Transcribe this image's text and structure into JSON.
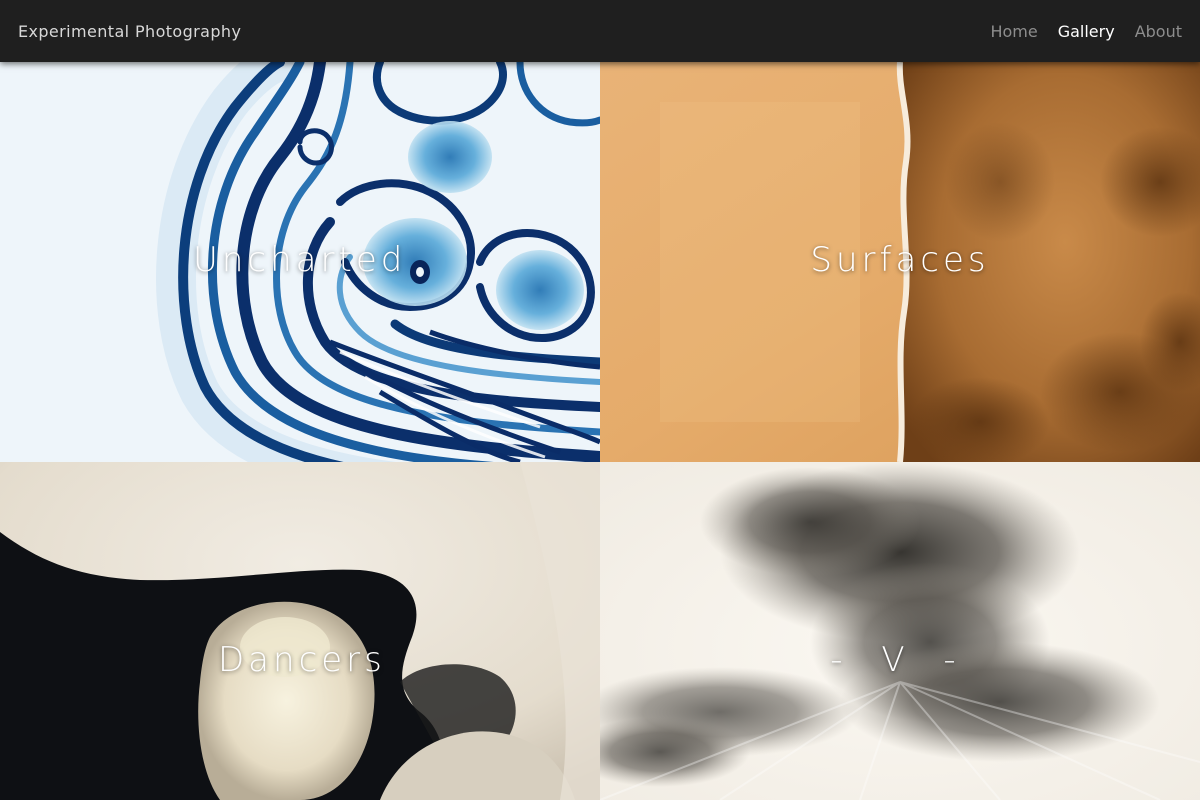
{
  "header": {
    "title": "Experimental Photography",
    "nav": [
      {
        "label": "Home",
        "active": false
      },
      {
        "label": "Gallery",
        "active": true
      },
      {
        "label": "About",
        "active": false
      }
    ]
  },
  "gallery": {
    "tiles": [
      {
        "title": "Uncharted"
      },
      {
        "title": "Surfaces"
      },
      {
        "title": "Dancers"
      },
      {
        "title": "- V -"
      }
    ]
  },
  "colors": {
    "header_bg": "#1f1f1f",
    "nav_active": "#ffffff",
    "nav_inactive": "#8d8d8d",
    "uncharted_blue": "#0d2f6e",
    "surfaces_ochre": "#e3ae6e",
    "surfaces_brown": "#8a5526",
    "dancers_cream": "#e8e2d6",
    "dancers_black": "#0e1014",
    "v_smoke": "#4a463f"
  }
}
